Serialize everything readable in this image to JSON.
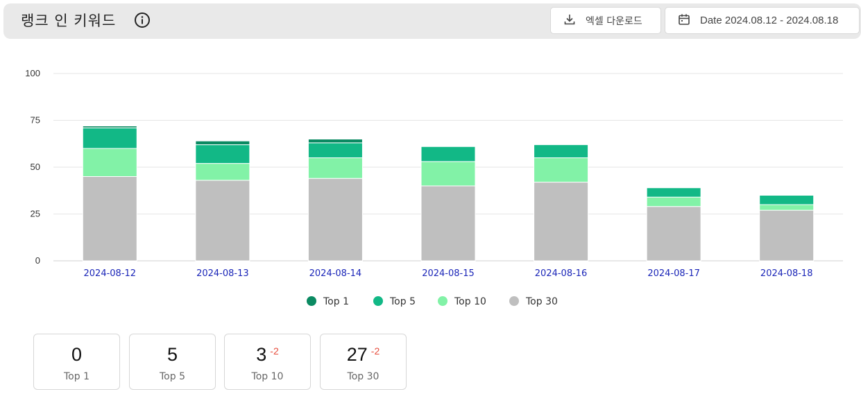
{
  "header": {
    "title": "랭크 인 키워드",
    "excel_button_label": "엑셀 다운로드",
    "date_button_label": "Date 2024.08.12 - 2024.08.18"
  },
  "colors": {
    "top1": "#0b8a62",
    "top5": "#12b886",
    "top10": "#82f2a7",
    "top30": "#bfbfbf",
    "axis_tick": "#1a25b8",
    "delta_negative": "#e74c3c"
  },
  "chart_data": {
    "type": "bar",
    "stacked": true,
    "categories": [
      "2024-08-12",
      "2024-08-13",
      "2024-08-14",
      "2024-08-15",
      "2024-08-16",
      "2024-08-17",
      "2024-08-18"
    ],
    "series": [
      {
        "name": "Top 30",
        "values": [
          45,
          43,
          44,
          40,
          42,
          29,
          27
        ]
      },
      {
        "name": "Top 10",
        "values": [
          15,
          9,
          11,
          13,
          13,
          5,
          3
        ]
      },
      {
        "name": "Top 5",
        "values": [
          11,
          10,
          8,
          8,
          7,
          5,
          5
        ]
      },
      {
        "name": "Top 1",
        "values": [
          1,
          2,
          2,
          0,
          0,
          0,
          0
        ]
      }
    ],
    "ylim": [
      0,
      100
    ],
    "yticks": [
      0,
      25,
      50,
      75,
      100
    ],
    "legend": [
      "Top 1",
      "Top 5",
      "Top 10",
      "Top 30"
    ],
    "legend_position": "bottom",
    "grid": true
  },
  "stats": [
    {
      "value": "0",
      "delta": "",
      "label": "Top 1"
    },
    {
      "value": "5",
      "delta": "",
      "label": "Top 5"
    },
    {
      "value": "3",
      "delta": "-2",
      "label": "Top 10"
    },
    {
      "value": "27",
      "delta": "-2",
      "label": "Top 30"
    }
  ]
}
